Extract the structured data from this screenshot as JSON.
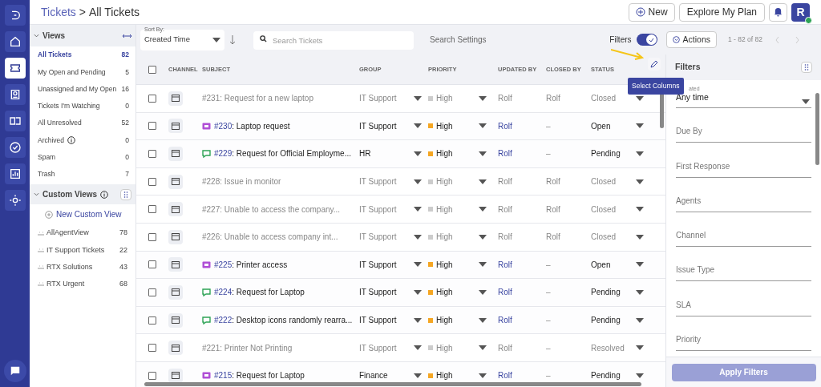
{
  "breadcrumb": {
    "parent": "Tickets",
    "separator": ">",
    "current": "All Tickets"
  },
  "header_buttons": {
    "new": "New",
    "plan": "Explore My Plan",
    "avatar": "R"
  },
  "views": {
    "title": "Views",
    "items": [
      {
        "label": "All Tickets",
        "count": "82",
        "selected": true,
        "info": false
      },
      {
        "label": "My Open and Pending",
        "count": "5",
        "selected": false,
        "info": false
      },
      {
        "label": "Unassigned and My Open",
        "count": "16",
        "selected": false,
        "info": false
      },
      {
        "label": "Tickets I'm Watching",
        "count": "0",
        "selected": false,
        "info": false
      },
      {
        "label": "All Unresolved",
        "count": "52",
        "selected": false,
        "info": false
      },
      {
        "label": "Archived",
        "count": "0",
        "selected": false,
        "info": true
      },
      {
        "label": "Spam",
        "count": "0",
        "selected": false,
        "info": false
      },
      {
        "label": "Trash",
        "count": "7",
        "selected": false,
        "info": false
      }
    ]
  },
  "custom_views": {
    "title": "Custom Views",
    "new_label": "New Custom View",
    "items": [
      {
        "label": "AllAgentView",
        "count": "78"
      },
      {
        "label": "IT Support Tickets",
        "count": "22"
      },
      {
        "label": "RTX Solutions",
        "count": "43"
      },
      {
        "label": "RTX Urgent",
        "count": "68"
      }
    ]
  },
  "toolbar": {
    "sort_label": "Sort By:",
    "sort_value": "Created Time",
    "search_placeholder": "Search Tickets",
    "search_settings": "Search Settings",
    "filters_label": "Filters",
    "filters_on": true,
    "actions": "Actions",
    "pagination": "1 - 82 of 82"
  },
  "table": {
    "select_all_checked": false,
    "columns": [
      "CHANNEL",
      "SUBJECT",
      "GROUP",
      "PRIORITY",
      "UPDATED BY",
      "CLOSED BY",
      "STATUS"
    ],
    "tooltip": "Select Columns",
    "rows": [
      {
        "kind": "none",
        "checked": false,
        "id": "#231",
        "subject": ": Request for a new laptop",
        "group": "IT Support",
        "priority": "High",
        "updated_by": "Rolf",
        "closed_by": "Rolf",
        "status": "Closed",
        "muted": true
      },
      {
        "kind": "ticket",
        "checked": false,
        "id": "#230",
        "subject": ": Laptop request",
        "group": "IT Support",
        "priority": "High",
        "updated_by": "Rolf",
        "closed_by": "–",
        "status": "Open",
        "muted": false
      },
      {
        "kind": "chat",
        "checked": false,
        "id": "#229",
        "subject": ": Request for Official Employme...",
        "group": "HR",
        "priority": "High",
        "updated_by": "Rolf",
        "closed_by": "–",
        "status": "Pending",
        "muted": false
      },
      {
        "kind": "none",
        "checked": false,
        "id": "#228",
        "subject": ": Issue in monitor",
        "group": "IT Support",
        "priority": "High",
        "updated_by": "Rolf",
        "closed_by": "Rolf",
        "status": "Closed",
        "muted": true
      },
      {
        "kind": "none",
        "checked": false,
        "id": "#227",
        "subject": ": Unable to access the company...",
        "group": "IT Support",
        "priority": "High",
        "updated_by": "Rolf",
        "closed_by": "Rolf",
        "status": "Closed",
        "muted": true
      },
      {
        "kind": "none",
        "checked": false,
        "id": "#226",
        "subject": ": Unable to access company int...",
        "group": "IT Support",
        "priority": "High",
        "updated_by": "Rolf",
        "closed_by": "Rolf",
        "status": "Closed",
        "muted": true
      },
      {
        "kind": "ticket",
        "checked": false,
        "id": "#225",
        "subject": ": Printer access",
        "group": "IT Support",
        "priority": "High",
        "updated_by": "Rolf",
        "closed_by": "–",
        "status": "Open",
        "muted": false
      },
      {
        "kind": "chat",
        "checked": false,
        "id": "#224",
        "subject": ": Request for Laptop",
        "group": "IT Support",
        "priority": "High",
        "updated_by": "Rolf",
        "closed_by": "–",
        "status": "Pending",
        "muted": false
      },
      {
        "kind": "chat",
        "checked": false,
        "id": "#222",
        "subject": ": Desktop icons randomly rearra...",
        "group": "IT Support",
        "priority": "High",
        "updated_by": "Rolf",
        "closed_by": "–",
        "status": "Pending",
        "muted": false
      },
      {
        "kind": "none",
        "checked": false,
        "id": "#221",
        "subject": ": Printer Not Printing",
        "group": "IT Support",
        "priority": "High",
        "updated_by": "Rolf",
        "closed_by": "–",
        "status": "Resolved",
        "muted": true
      },
      {
        "kind": "ticket",
        "checked": false,
        "id": "#215",
        "subject": ": Request for Laptop",
        "group": "Finance",
        "priority": "High",
        "updated_by": "Rolf",
        "closed_by": "–",
        "status": "Pending",
        "muted": false
      }
    ]
  },
  "filters": {
    "title": "Filters",
    "created_label": "ated",
    "created_value": "Any time",
    "fields": [
      "Due By",
      "First Response",
      "Agents",
      "Channel",
      "Issue Type",
      "SLA",
      "Priority"
    ],
    "apply": "Apply Filters"
  }
}
